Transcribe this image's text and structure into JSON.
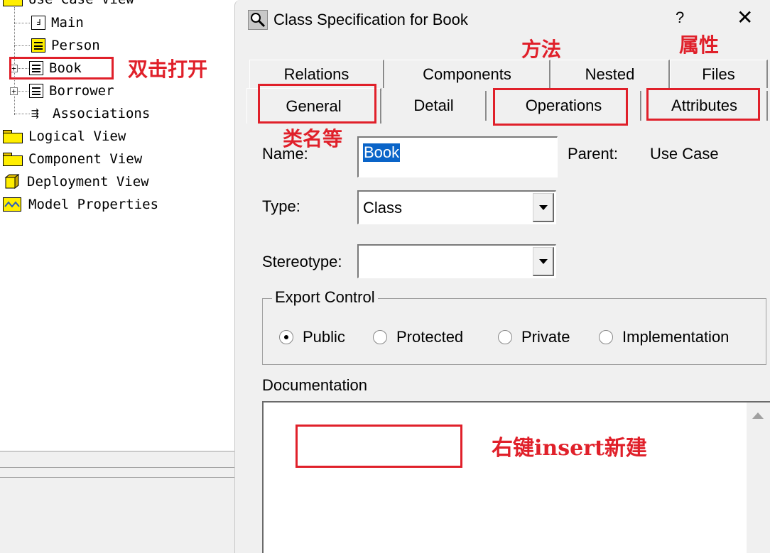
{
  "tree": {
    "items": [
      {
        "label": "Use Case View",
        "icon": "folder-icon"
      },
      {
        "label": "Main",
        "icon": "diagram-icon"
      },
      {
        "label": "Person",
        "icon": "actor-class-icon"
      },
      {
        "label": "Book",
        "icon": "class-icon",
        "expander": "+"
      },
      {
        "label": "Borrower",
        "icon": "class-icon",
        "expander": "+"
      },
      {
        "label": "Associations",
        "icon": "associations-icon"
      },
      {
        "label": "Logical View",
        "icon": "folder-icon"
      },
      {
        "label": "Component View",
        "icon": "folder-icon"
      },
      {
        "label": "Deployment View",
        "icon": "deployment-icon"
      },
      {
        "label": "Model Properties",
        "icon": "model-properties-icon"
      }
    ]
  },
  "dialog": {
    "title": "Class Specification for Book",
    "help": "?",
    "close": "✕",
    "tabs_back": [
      "Relations",
      "Components",
      "Nested",
      "Files"
    ],
    "tabs_front": [
      "General",
      "Detail",
      "Operations",
      "Attributes"
    ],
    "active_tab": "General",
    "name_label": "Name:",
    "name_value": "Book",
    "parent_label": "Parent:",
    "parent_value": "Use Case",
    "type_label": "Type:",
    "type_value": "Class",
    "stereotype_label": "Stereotype:",
    "stereotype_value": "",
    "export_label": "Export Control",
    "export_options": [
      "Public",
      "Protected",
      "Private",
      "Implementation"
    ],
    "export_selected": "Public",
    "doc_label": "Documentation"
  },
  "annotations": {
    "double_click": "双击打开",
    "methods": "方法",
    "attributes": "属性",
    "class_name": "类名等",
    "right_click": "右键insert新建",
    "color": "#e0202a"
  }
}
